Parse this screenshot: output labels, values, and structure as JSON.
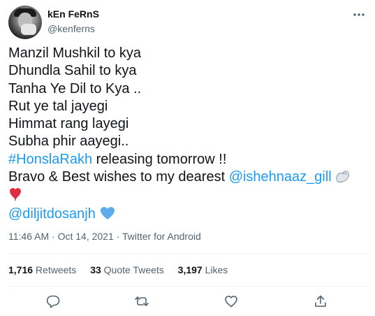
{
  "author": {
    "display_name": "kEn FeRnS",
    "handle": "@kenferns"
  },
  "tweet": {
    "lines": [
      "Manzil Mushkil to kya",
      "Dhundla Sahil to kya",
      "Tanha Ye Dil to Kya ..",
      "Rut ye tal jayegi",
      "Himmat rang layegi",
      "Subha phir aayegi.."
    ],
    "hashtag": "#HonslaRakh",
    "hashtag_suffix": " releasing tomorrow !!",
    "wishes_prefix": "Bravo & Best wishes to my dearest ",
    "mention_1": "@ishehnaaz_gill",
    "mention_2": "@diljitdosanjh"
  },
  "meta": {
    "time": "11:46 AM",
    "separator_1": " · ",
    "date": "Oct 14, 2021",
    "separator_2": " · ",
    "source": "Twitter for Android"
  },
  "stats": {
    "retweets_count": "1,716",
    "retweets_label": " Retweets",
    "quote_count": "33",
    "quote_label": " Quote Tweets",
    "likes_count": "3,197",
    "likes_label": " Likes"
  },
  "icons": {
    "more": "more-icon",
    "reply": "reply-icon",
    "retweet": "retweet-icon",
    "like": "like-icon",
    "share": "share-icon",
    "flexed_biceps": "flexed-biceps-emoji",
    "red_heart": "red-heart-emoji",
    "blue_heart": "blue-heart-emoji"
  },
  "colors": {
    "link": "#1d9bf0",
    "text": "#0f1419",
    "secondary": "#536471",
    "divider": "#eff3f4"
  }
}
